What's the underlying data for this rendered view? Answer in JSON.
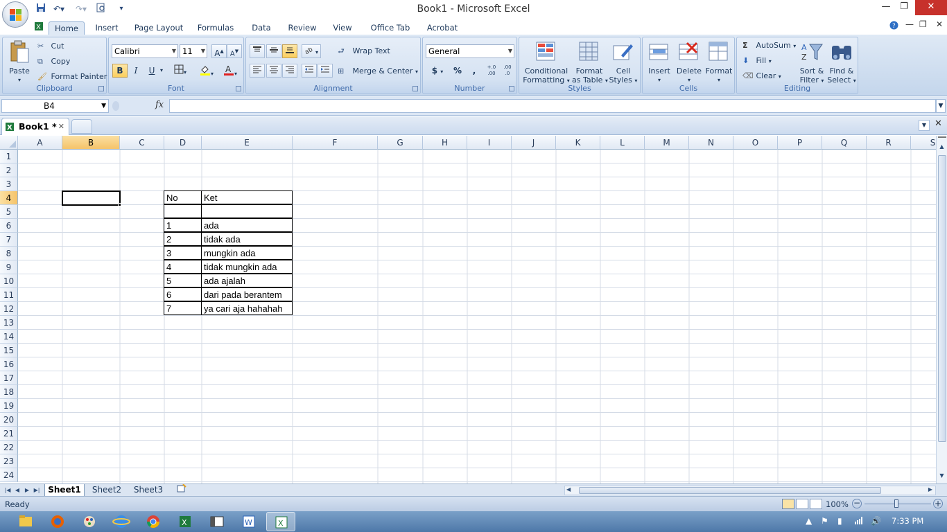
{
  "window": {
    "title": "Book1 - Microsoft Excel"
  },
  "ribbon_tabs": [
    "Home",
    "Insert",
    "Page Layout",
    "Formulas",
    "Data",
    "Review",
    "View",
    "Office Tab",
    "Acrobat"
  ],
  "clipboard": {
    "paste": "Paste",
    "cut": "Cut",
    "copy": "Copy",
    "format_painter": "Format Painter",
    "label": "Clipboard"
  },
  "font": {
    "name": "Calibri",
    "size": "11",
    "bold": "B",
    "italic": "I",
    "underline": "U",
    "label": "Font",
    "grow": "A",
    "shrink": "A"
  },
  "alignment": {
    "wrap": "Wrap Text",
    "merge": "Merge & Center",
    "label": "Alignment"
  },
  "number": {
    "format": "General",
    "currency": "$",
    "percent": "%",
    "comma": ",",
    "inc_decimal": "+.0 .00",
    "dec_decimal": ".00 .0",
    "label": "Number"
  },
  "styles": {
    "conditional_1": "Conditional",
    "conditional_2": "Formatting",
    "table_1": "Format",
    "table_2": "as Table",
    "cell_1": "Cell",
    "cell_2": "Styles",
    "label": "Styles"
  },
  "cells": {
    "insert": "Insert",
    "delete": "Delete",
    "format": "Format",
    "label": "Cells"
  },
  "editing": {
    "autosum": "AutoSum",
    "fill": "Fill",
    "clear": "Clear",
    "sort_1": "Sort &",
    "sort_2": "Filter",
    "find_1": "Find &",
    "find_2": "Select",
    "label": "Editing"
  },
  "formula_bar": {
    "name_box": "B4",
    "fx": "fx",
    "value": ""
  },
  "workbook_tab": {
    "name": "Book1 *"
  },
  "columns": [
    "A",
    "B",
    "C",
    "D",
    "E",
    "F",
    "G",
    "H",
    "I",
    "J",
    "K",
    "L",
    "M",
    "N",
    "O",
    "P",
    "Q",
    "R",
    "S"
  ],
  "rows": [
    "1",
    "2",
    "3",
    "4",
    "5",
    "6",
    "7",
    "8",
    "9",
    "10",
    "11",
    "12",
    "13",
    "14",
    "15",
    "16",
    "17",
    "18",
    "19",
    "20",
    "21",
    "22",
    "23",
    "24"
  ],
  "table": {
    "header": {
      "no": "No",
      "ket": "Ket"
    },
    "rows": [
      {
        "no": "",
        "ket": ""
      },
      {
        "no": "1",
        "ket": "ada"
      },
      {
        "no": "2",
        "ket": "tidak ada"
      },
      {
        "no": "3",
        "ket": "mungkin ada"
      },
      {
        "no": "4",
        "ket": "tidak mungkin ada"
      },
      {
        "no": "5",
        "ket": "ada ajalah"
      },
      {
        "no": "6",
        "ket": "dari pada berantem"
      },
      {
        "no": "7",
        "ket": "ya cari aja hahahah"
      }
    ]
  },
  "sheets": [
    "Sheet1",
    "Sheet2",
    "Sheet3"
  ],
  "status": {
    "text": "Ready",
    "zoom": "100%"
  },
  "taskbar": {
    "clock": "7:33 PM"
  },
  "icons": {
    "office": "office-button-icon",
    "save": "save-icon",
    "undo": "undo-icon",
    "redo": "redo-icon",
    "print_preview": "print-preview-icon"
  }
}
